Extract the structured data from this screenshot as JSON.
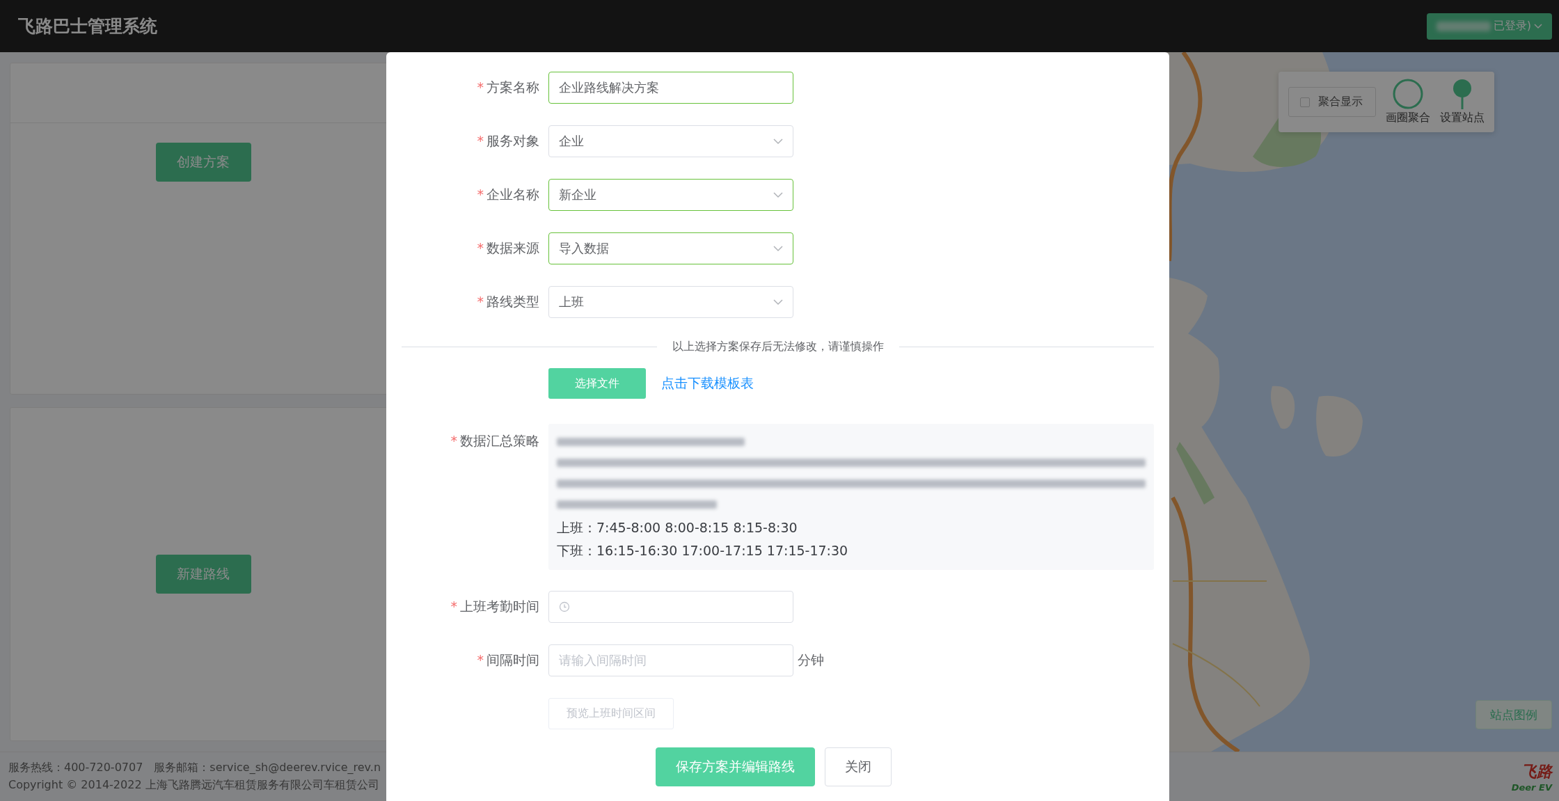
{
  "header": {
    "title": "飞路巴士管理系统",
    "user_menu": {
      "label": "已登录)"
    }
  },
  "left_panel": {
    "cards": [
      {
        "kind": "top",
        "button": "创建方案"
      },
      {
        "kind": "middle",
        "button": "新建路线"
      }
    ]
  },
  "map_tools": {
    "aggregate_toggle": {
      "label": "聚合显示",
      "checked": false
    },
    "tools": [
      {
        "kind": "circle",
        "label": "画圈聚合"
      },
      {
        "kind": "pin",
        "label": "设置站点"
      }
    ],
    "legend_button": "站点图例"
  },
  "logo": {
    "name": "飞路",
    "subtitle": "Deer EV"
  },
  "footer": {
    "lines": [
      "服务热线：400-720-0707　服务邮箱：service_sh@deerev.rvice_rev.n",
      "Copyright © 2014-2022 上海飞路腾远汽车租赁服务有限公司车租赁公司"
    ]
  },
  "modal": {
    "fields": [
      {
        "label": "方案名称",
        "required_mark": "*",
        "kind": "input",
        "value": "企业路线解决方案",
        "valid": true
      },
      {
        "label": "服务对象",
        "required_mark": "*",
        "kind": "select",
        "value": "企业",
        "valid": false
      },
      {
        "label": "企业名称",
        "required_mark": "*",
        "kind": "select",
        "value": "新企业",
        "valid": true
      },
      {
        "label": "数据来源",
        "required_mark": "*",
        "kind": "select",
        "value": "导入数据",
        "valid": true
      },
      {
        "label": "路线类型",
        "required_mark": "*",
        "kind": "select",
        "value": "上班",
        "valid": false
      }
    ],
    "notice": "以上选择方案保存后无法修改，请谨慎操作",
    "file_button": "选择文件",
    "template_link": "点击下载模板表",
    "strategy": {
      "label": "数据汇总策略",
      "required_mark": "*",
      "lines": [
        "上班：7:45-8:00 8:00-8:15 8:15-8:30",
        "下班：16:15-16:30 17:00-17:15 17:15-17:30"
      ]
    },
    "time_fields": [
      {
        "label": "上班考勤时间",
        "required_mark": "*",
        "kind": "time"
      },
      {
        "label": "间隔时间",
        "required_mark": "*",
        "kind": "input",
        "placeholder": "请输入间隔时间",
        "suffix": "分钟"
      }
    ],
    "preview_button": {
      "label": "预览上班时间区间",
      "disabled": true
    },
    "actions": [
      {
        "label": "保存方案并编辑路线",
        "kind": "primary"
      },
      {
        "label": "关闭",
        "kind": "default"
      }
    ]
  }
}
